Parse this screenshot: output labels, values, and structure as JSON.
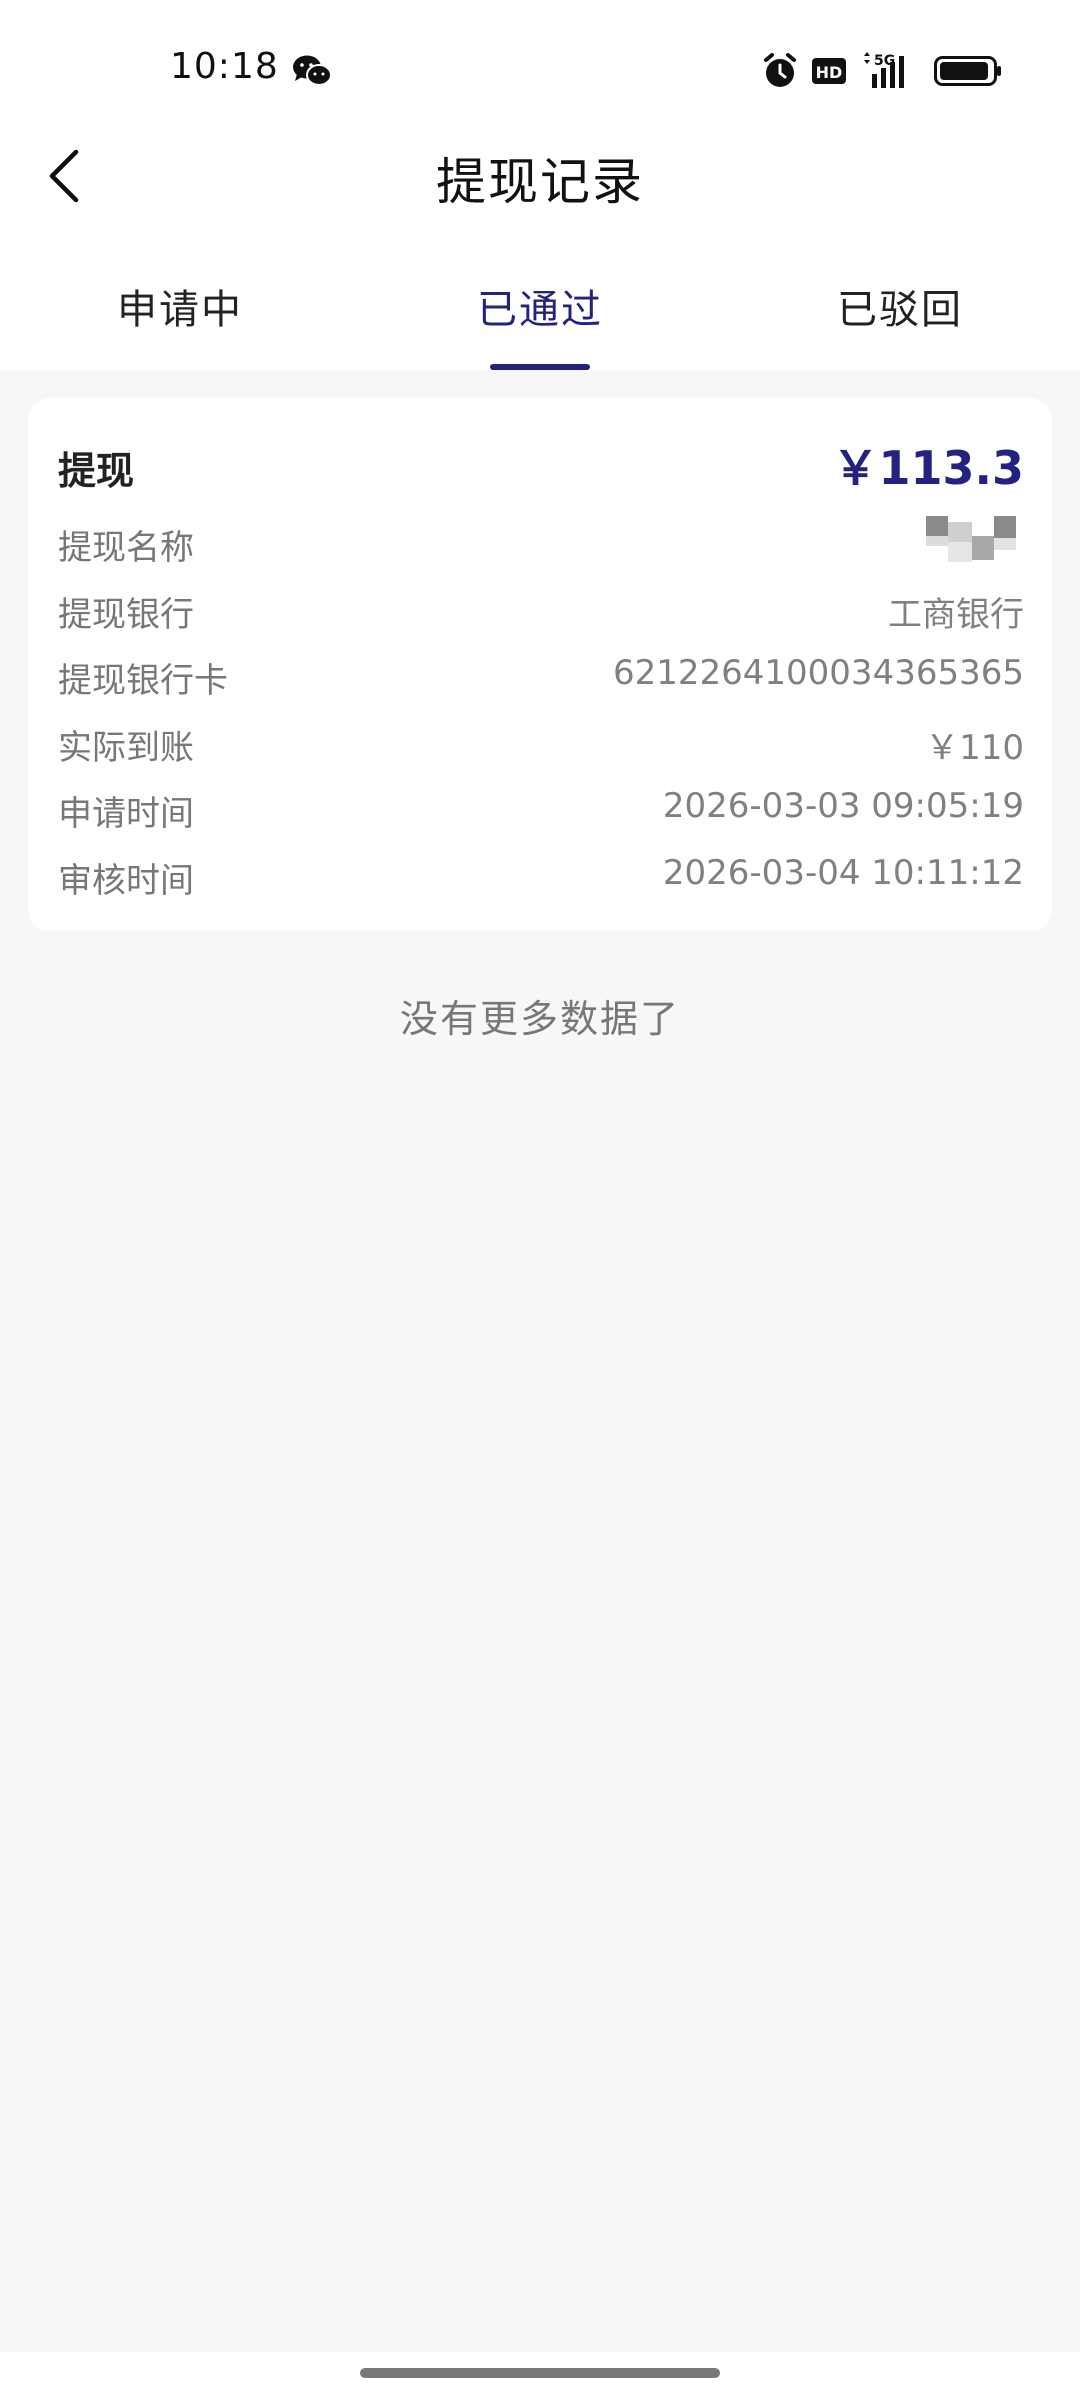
{
  "status_bar": {
    "time": "10:18",
    "network_label": "5G",
    "hd_label": "HD",
    "icons": [
      "wechat-icon",
      "alarm-icon",
      "hd-icon",
      "signal-5g-icon",
      "battery-icon"
    ]
  },
  "nav": {
    "title": "提现记录",
    "back_icon": "chevron-left-icon"
  },
  "tabs": [
    {
      "label": "申请中",
      "active": false
    },
    {
      "label": "已通过",
      "active": true
    },
    {
      "label": "已驳回",
      "active": false
    }
  ],
  "record": {
    "title": "提现",
    "amount": "￥113.3",
    "rows": [
      {
        "label": "提现名称",
        "value": ""
      },
      {
        "label": "提现银行",
        "value": "工商银行"
      },
      {
        "label": "提现银行卡",
        "value": "6212264100034365365"
      },
      {
        "label": "实际到账",
        "value": "￥110"
      },
      {
        "label": "申请时间",
        "value": "2026-03-03 09:05:19"
      },
      {
        "label": "审核时间",
        "value": "2026-03-04 10:11:12"
      }
    ]
  },
  "list_footer": {
    "no_more_text": "没有更多数据了"
  },
  "colors": {
    "accent": "#23227e",
    "background": "#f7f7f7",
    "card": "#ffffff",
    "label_text": "#777777"
  }
}
